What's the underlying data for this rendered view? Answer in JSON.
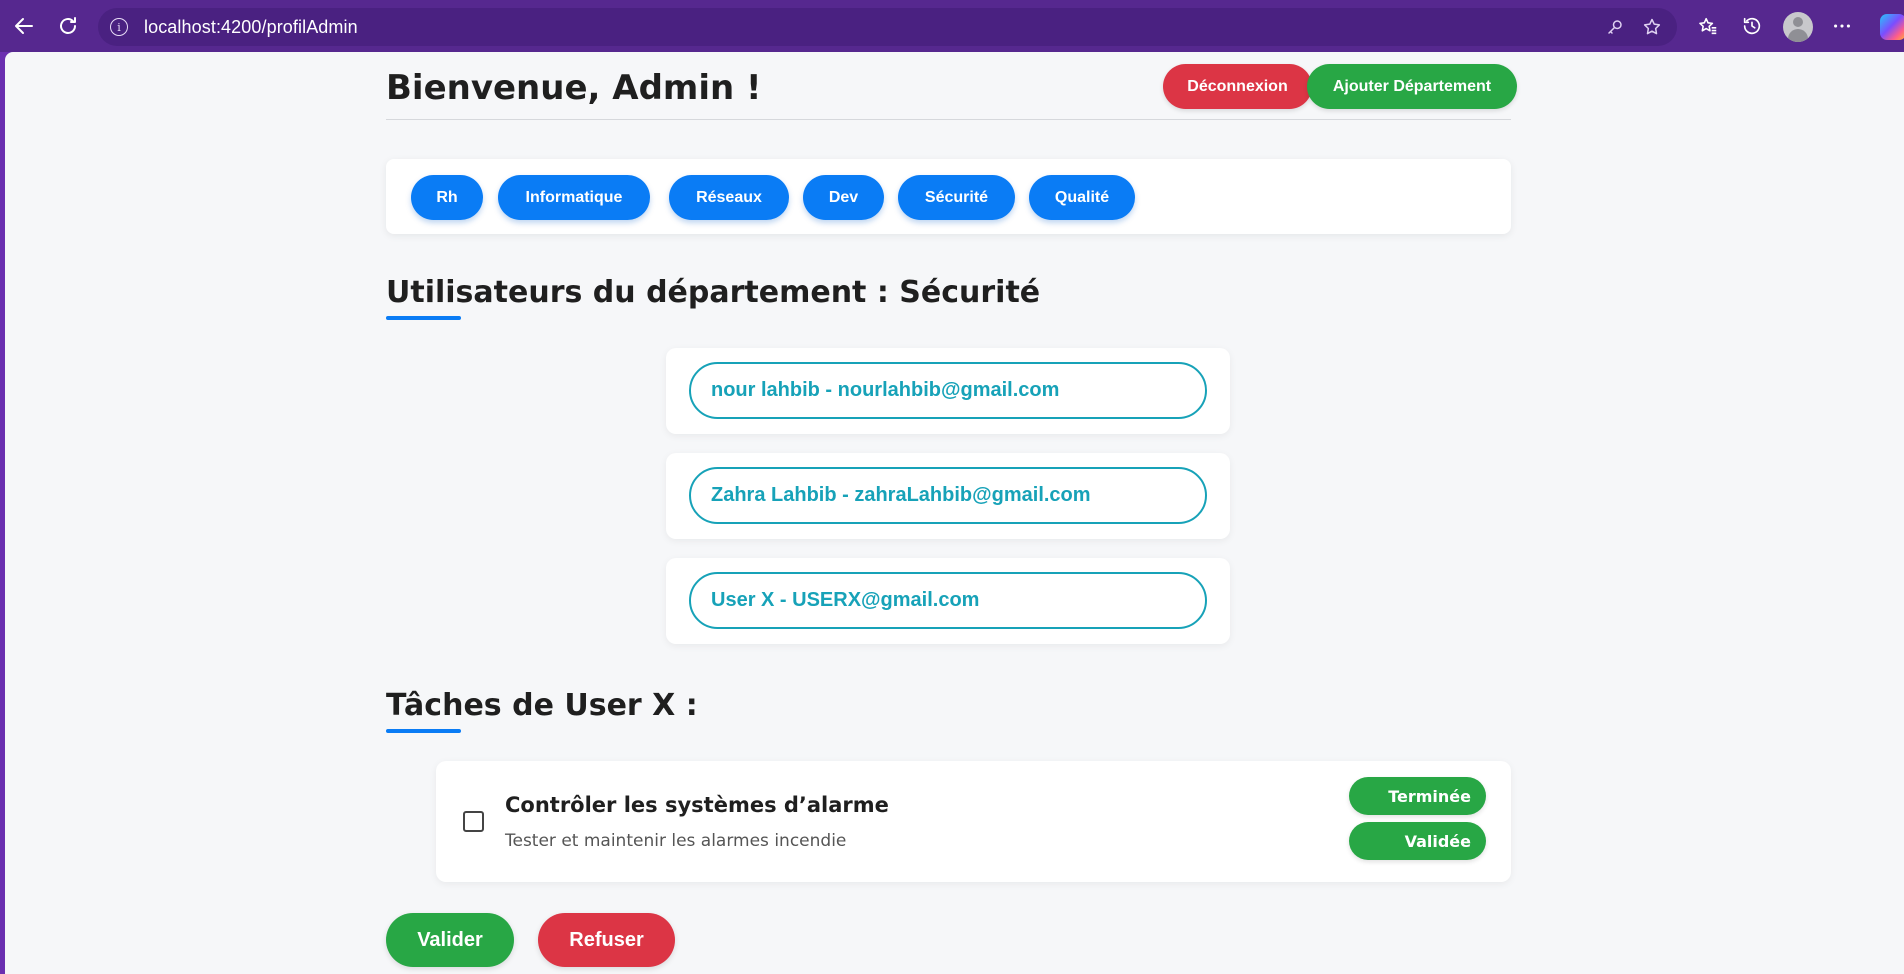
{
  "browser": {
    "url": "localhost:4200/profilAdmin",
    "info_icon": "i"
  },
  "header": {
    "welcome": "Bienvenue, Admin !",
    "logout_label": "Déconnexion",
    "add_department_label": "Ajouter Département"
  },
  "departments": [
    "Rh",
    "Informatique",
    "Réseaux",
    "Dev",
    "Sécurité",
    "Qualité"
  ],
  "users_section": {
    "title": "Utilisateurs du département : Sécurité",
    "users": [
      "nour lahbib - nourlahbib@gmail.com",
      "Zahra Lahbib - zahraLahbib@gmail.com",
      "User X - USERX@gmail.com"
    ]
  },
  "tasks_section": {
    "title": "Tâches de User X :",
    "task": {
      "title": "Contrôler les systèmes d’alarme",
      "description": "Tester et maintenir les alarmes incendie",
      "status_terminee": "Terminée",
      "status_validee": "Validée"
    }
  },
  "actions": {
    "valider": "Valider",
    "refuser": "Refuser"
  },
  "colors": {
    "primary_blue": "#0a7cf5",
    "success_green": "#28a745",
    "danger_red": "#dc3545",
    "info_teal": "#17a2b8",
    "browser_purple": "#56288f"
  }
}
